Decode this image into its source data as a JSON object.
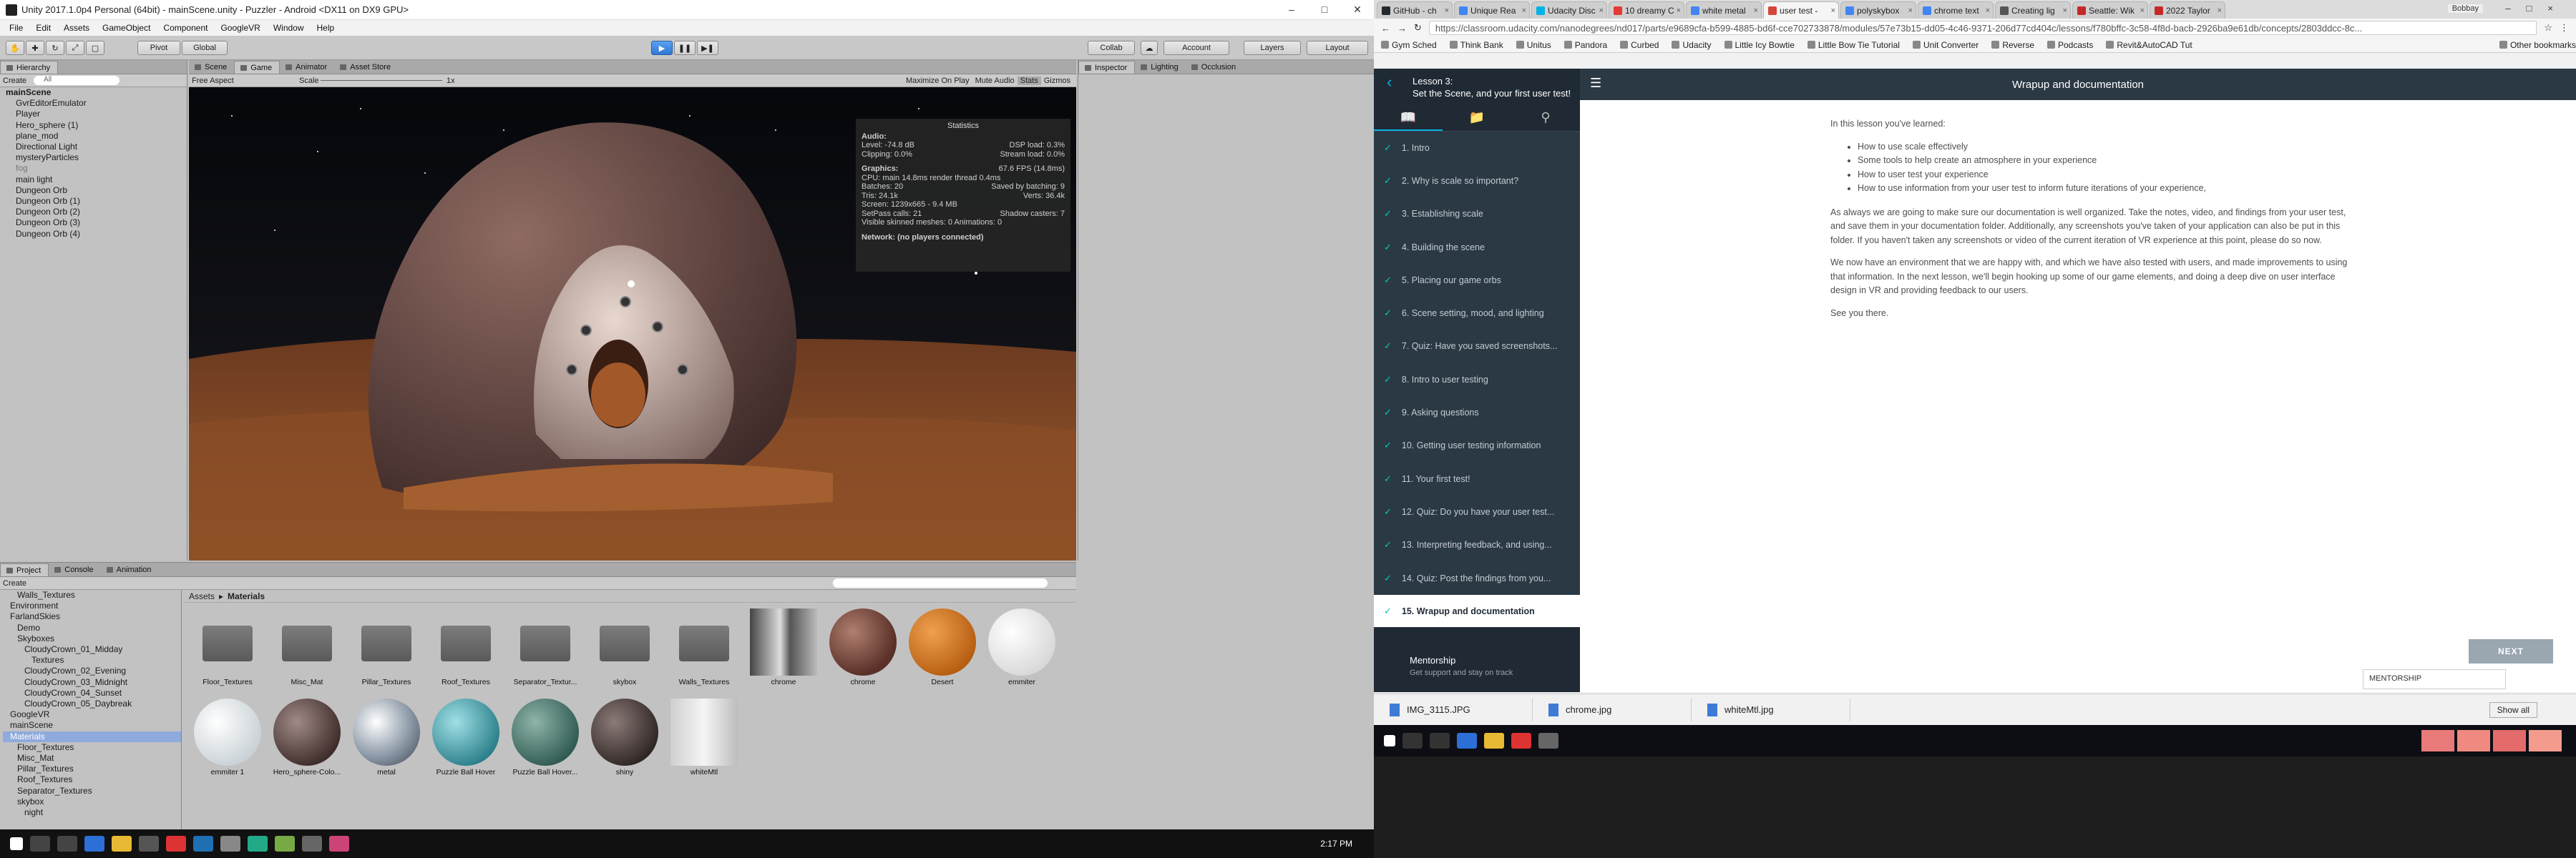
{
  "unity": {
    "title": "Unity 2017.1.0p4 Personal (64bit) - mainScene.unity - Puzzler - Android <DX11 on DX9 GPU>",
    "menu": [
      "File",
      "Edit",
      "Assets",
      "GameObject",
      "Component",
      "GoogleVR",
      "Window",
      "Help"
    ],
    "toolbar": {
      "pivot": "Pivot",
      "global": "Global",
      "collab": "Collab",
      "account": "Account",
      "layers": "Layers",
      "layout": "Layout"
    },
    "hierarchy": {
      "tab": "Hierarchy",
      "create": "Create",
      "search_placeholder": "All",
      "items": [
        "mainScene",
        "GvrEditorEmulator",
        "Player",
        "Hero_sphere (1)",
        "plane_mod",
        "Directional Light",
        "mysteryParticles",
        "fog",
        "main light",
        "Dungeon Orb",
        "Dungeon Orb (1)",
        "Dungeon Orb (2)",
        "Dungeon Orb (3)",
        "Dungeon Orb (4)"
      ]
    },
    "game_tabs": [
      "Scene",
      "Game",
      "Animator",
      "Asset Store"
    ],
    "game_bar": {
      "aspect": "Free Aspect",
      "scale": "Scale",
      "scale_val": "1x",
      "maximize": "Maximize On Play",
      "mute": "Mute Audio",
      "stats": "Stats",
      "gizmos": "Gizmos"
    },
    "stats": {
      "title": "Statistics",
      "audio": "Audio:",
      "level": "Level: -74.8 dB",
      "dsp": "DSP load: 0.3%",
      "clipping": "Clipping: 0.0%",
      "stream": "Stream load: 0.0%",
      "graphics": "Graphics:",
      "fps": "67.6 FPS (14.8ms)",
      "cpu": "CPU: main 14.8ms  render thread 0.4ms",
      "batches": "Batches: 20",
      "saved": "Saved by batching: 9",
      "tris": "Tris: 24.1k",
      "verts": "Verts: 36.4k",
      "screen": "Screen: 1239x665 - 9.4 MB",
      "setpass": "SetPass calls: 21",
      "shadow": "Shadow casters: 7",
      "skinned": "Visible skinned meshes: 0  Animations: 0",
      "network": "Network: (no players connected)"
    },
    "inspector_tabs": [
      "Inspector",
      "Lighting",
      "Occlusion"
    ],
    "bottom_tabs": [
      "Project",
      "Console",
      "Animation"
    ],
    "project": {
      "create": "Create",
      "breadcrumb": [
        "Assets",
        "Materials"
      ],
      "tree": [
        "Walls_Textures",
        "Environment",
        "FarlandSkies",
        "Demo",
        "Skyboxes",
        "CloudyCrown_01_Midday",
        "Textures",
        "CloudyCrown_02_Evening",
        "CloudyCrown_03_Midnight",
        "CloudyCrown_04_Sunset",
        "CloudyCrown_05_Daybreak",
        "GoogleVR",
        "mainScene",
        "Materials",
        "Floor_Textures",
        "Misc_Mat",
        "Pillar_Textures",
        "Roof_Textures",
        "Separator_Textures",
        "skybox",
        "night"
      ],
      "assets": [
        {
          "name": "Floor_Textures",
          "kind": "folder"
        },
        {
          "name": "Misc_Mat",
          "kind": "folder"
        },
        {
          "name": "Pillar_Textures",
          "kind": "folder"
        },
        {
          "name": "Roof_Textures",
          "kind": "folder"
        },
        {
          "name": "Separator_Textur...",
          "kind": "folder"
        },
        {
          "name": "skybox",
          "kind": "folder"
        },
        {
          "name": "Walls_Textures",
          "kind": "folder"
        },
        {
          "name": "chrome",
          "kind": "chrome"
        },
        {
          "name": "chrome",
          "kind": "rock"
        },
        {
          "name": "Desert",
          "kind": "orange"
        },
        {
          "name": "emmiter",
          "kind": "white"
        },
        {
          "name": "emmiter 1",
          "kind": "white2"
        },
        {
          "name": "Hero_sphere-Colo...",
          "kind": "brown"
        },
        {
          "name": "metal",
          "kind": "metal"
        },
        {
          "name": "Puzzle Ball Hover",
          "kind": "teal"
        },
        {
          "name": "Puzzle Ball Hover...",
          "kind": "teal2"
        },
        {
          "name": "shiny",
          "kind": "shiny"
        },
        {
          "name": "whiteMtl",
          "kind": "tile"
        }
      ]
    },
    "clock": "2:17 PM"
  },
  "chrome": {
    "tabs": [
      {
        "label": "GitHub - ch",
        "color": "#24292e"
      },
      {
        "label": "Unique Rea",
        "color": "#4285f4"
      },
      {
        "label": "Udacity Disc",
        "color": "#02b3e4"
      },
      {
        "label": "10 dreamy C",
        "color": "#e53935"
      },
      {
        "label": "white metal",
        "color": "#4285f4"
      },
      {
        "label": "user test -",
        "color": "#d44638"
      },
      {
        "label": "polyskybox",
        "color": "#4285f4"
      },
      {
        "label": "chrome text",
        "color": "#4285f4"
      },
      {
        "label": "Creating lig",
        "color": "#555555"
      },
      {
        "label": "Seattle: Wik",
        "color": "#c62828"
      },
      {
        "label": "2022 Taylor",
        "color": "#c62828"
      }
    ],
    "window_user": "Bobbay",
    "url": "https://classroom.udacity.com/nanodegrees/nd017/parts/e9689cfa-b599-4885-bd6f-cce702733878/modules/57e73b15-dd05-4c46-9371-206d77cd404c/lessons/f780bffc-3c58-4f8d-bacb-2926ba9e61db/concepts/2803ddcc-8c...",
    "bookmarks": [
      "Gym Sched",
      "Think Bank",
      "Unitus",
      "Pandora",
      "Curbed",
      "Udacity",
      "Little Icy Bowtie",
      "Little Bow Tie Tutorial",
      "Unit Converter",
      "Reverse",
      "Podcasts",
      "Revit&AutoCAD Tut",
      "Other bookmarks"
    ],
    "lesson": {
      "label": "Lesson 3:",
      "title": "Set the Scene, and your first user test!"
    },
    "concepts": [
      "1. Intro",
      "2. Why is scale so important?",
      "3. Establishing scale",
      "4. Building the scene",
      "5. Placing our game orbs",
      "6. Scene setting, mood, and lighting",
      "7. Quiz: Have you saved screenshots...",
      "8. Intro to user testing",
      "9. Asking questions",
      "10. Getting user testing information",
      "11. Your first test!",
      "12. Quiz: Do you have your user test...",
      "13. Interpreting feedback, and using...",
      "14. Quiz: Post the findings from you...",
      "15. Wrapup and documentation"
    ],
    "mentorship": {
      "title": "Mentorship",
      "subtitle": "Get support and stay on track"
    },
    "page_title": "Wrapup and documentation",
    "content": {
      "intro": "In this lesson you've learned:",
      "bullets": [
        "How to use scale effectively",
        "Some tools to help create an atmosphere in your experience",
        "How to user test your experience",
        "How to use information from your user test to inform future iterations of your experience,"
      ],
      "p1": "As always we are going to make sure our documentation is well organized. Take the notes, video, and findings from your user test, and save them in your documentation folder. Additionally, any screenshots you've taken of your application can also be put in this folder. If you haven't taken any screenshots or video of the current iteration of VR experience at this point, please do so now.",
      "p2": "We now have an environment that we are happy with, and which we have also tested with users, and made improvements to using that information. In the next lesson, we'll begin hooking up some of our game elements, and doing a deep dive on user interface design in VR and providing feedback to our users.",
      "p3": "See you there."
    },
    "next": "NEXT",
    "mentor_chat": "MENTORSHIP",
    "downloads": [
      "IMG_3115.JPG",
      "chrome.jpg",
      "whiteMtl.jpg"
    ],
    "show_all": "Show all"
  }
}
